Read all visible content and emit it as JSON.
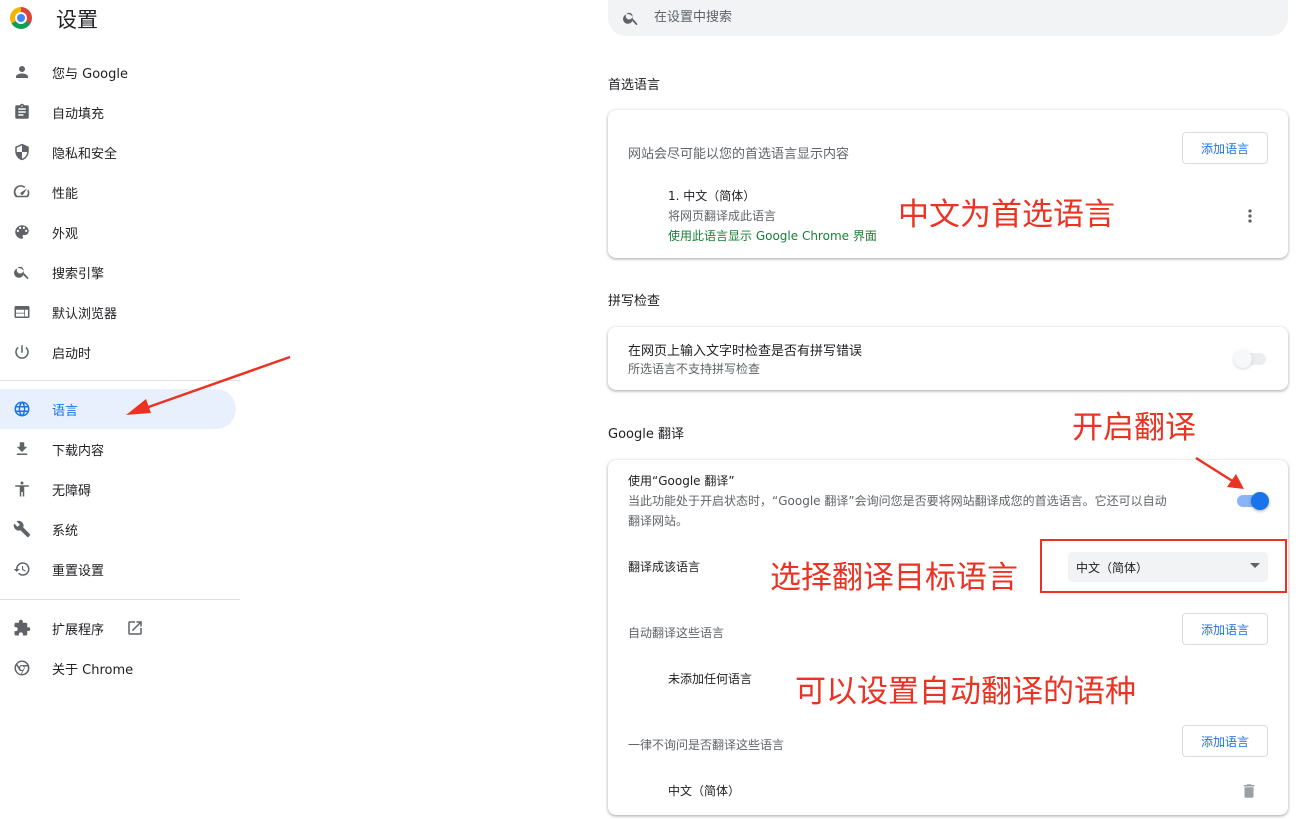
{
  "app": {
    "title": "设置"
  },
  "sidebar": {
    "items": [
      {
        "label": "您与 Google",
        "icon": "person-icon"
      },
      {
        "label": "自动填充",
        "icon": "clipboard-icon"
      },
      {
        "label": "隐私和安全",
        "icon": "shield-icon"
      },
      {
        "label": "性能",
        "icon": "speedometer-icon"
      },
      {
        "label": "外观",
        "icon": "palette-icon"
      },
      {
        "label": "搜索引擎",
        "icon": "search-icon"
      },
      {
        "label": "默认浏览器",
        "icon": "browser-window-icon"
      },
      {
        "label": "启动时",
        "icon": "power-icon"
      },
      {
        "label": "语言",
        "icon": "globe-icon",
        "active": true
      },
      {
        "label": "下载内容",
        "icon": "download-icon"
      },
      {
        "label": "无障碍",
        "icon": "accessibility-icon"
      },
      {
        "label": "系统",
        "icon": "wrench-icon"
      },
      {
        "label": "重置设置",
        "icon": "history-icon"
      }
    ],
    "extensions_label": "扩展程序",
    "about_label": "关于 Chrome"
  },
  "search": {
    "placeholder": "在设置中搜索"
  },
  "preferred_languages": {
    "heading": "首选语言",
    "description": "网站会尽可能以您的首选语言显示内容",
    "add_button": "添加语言",
    "language_name": "1. 中文（简体）",
    "language_note": "将网页翻译成此语言",
    "ui_language_note": "使用此语言显示 Google Chrome 界面"
  },
  "spell_check": {
    "heading": "拼写检查",
    "title": "在网页上输入文字时检查是否有拼写错误",
    "subtitle": "所选语言不支持拼写检查",
    "enabled": false
  },
  "google_translate": {
    "heading": "Google 翻译",
    "use_title": "使用“Google 翻译”",
    "use_desc_line1": "当此功能处于开启状态时，“Google 翻译”会询问您是否要将网站翻译成您的首选语言。它还可以自动",
    "use_desc_line2": "翻译网站。",
    "enabled": true,
    "target_label": "翻译成该语言",
    "target_value": "中文（简体）",
    "auto_translate_label": "自动翻译这些语言",
    "auto_add_button": "添加语言",
    "auto_empty": "未添加任何语言",
    "never_label": "一律不询问是否翻译这些语言",
    "never_add_button": "添加语言",
    "never_language": "中文（简体）"
  },
  "annotations": {
    "preferred": "中文为首选语言",
    "enable": "开启翻译",
    "choose_target": "选择翻译目标语言",
    "auto_langs": "可以设置自动翻译的语种"
  },
  "colors": {
    "accent": "#1a73e8",
    "annotation_red": "#ea3323",
    "green_text": "#188038"
  }
}
